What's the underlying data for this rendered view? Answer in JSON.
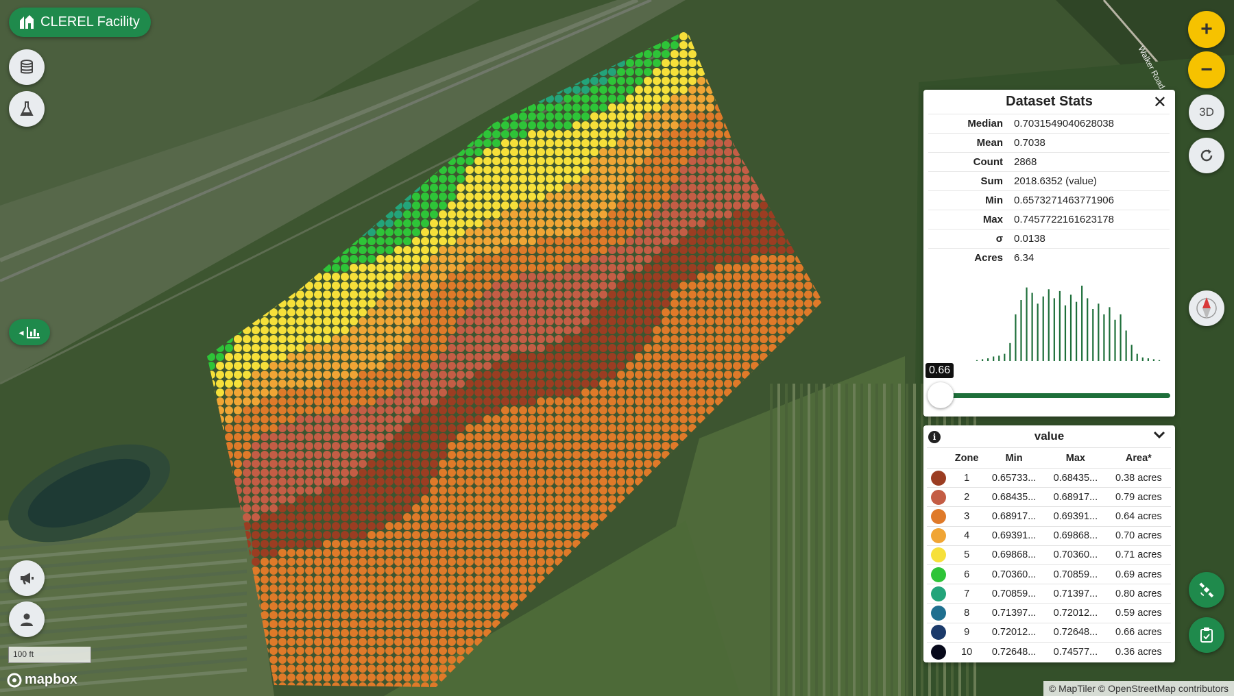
{
  "facility": {
    "label": "CLEREL Facility",
    "icon": "facility-logo-icon"
  },
  "left_controls": {
    "datasets": "database-icon",
    "lab": "flask-icon",
    "stats_toggle": "chart-icon",
    "announcements": "megaphone-icon",
    "account": "user-icon"
  },
  "right_controls": {
    "zoom_in": "+",
    "zoom_out": "−",
    "view_3d": "3D",
    "reset": "refresh-icon",
    "compass": "compass-icon",
    "satellite": "satellite-icon",
    "report": "clipboard-icon"
  },
  "map": {
    "scale_label": "100 ft",
    "logo_text": "mapbox",
    "attribution": "© MapTiler © OpenStreetMap contributors",
    "road_label": "Walker Road"
  },
  "stats": {
    "title": "Dataset Stats",
    "close": "✕",
    "rows": [
      {
        "key": "Median",
        "value": "0.7031549040628038"
      },
      {
        "key": "Mean",
        "value": "0.7038"
      },
      {
        "key": "Count",
        "value": "2868"
      },
      {
        "key": "Sum",
        "value": "2018.6352 (value)"
      },
      {
        "key": "Min",
        "value": "0.6573271463771906"
      },
      {
        "key": "Max",
        "value": "0.7457722161623178"
      },
      {
        "key": "σ",
        "value": "0.0138"
      },
      {
        "key": "Acres",
        "value": "6.34"
      }
    ],
    "histogram": [
      1,
      2,
      3,
      5,
      6,
      8,
      20,
      52,
      68,
      82,
      76,
      64,
      72,
      80,
      70,
      78,
      62,
      74,
      66,
      84,
      70,
      58,
      64,
      52,
      60,
      46,
      52,
      34,
      18,
      8,
      4,
      3,
      2,
      1
    ],
    "slider_value": "0.66",
    "slider_fraction": 0.0
  },
  "legend": {
    "title": "value",
    "headers": [
      "Zone",
      "Min",
      "Max",
      "Area*"
    ],
    "zones": [
      {
        "zone": "1",
        "min": "0.65733...",
        "max": "0.68435...",
        "area": "0.38 acres",
        "color": "#9b3d22"
      },
      {
        "zone": "2",
        "min": "0.68435...",
        "max": "0.68917...",
        "area": "0.79 acres",
        "color": "#c45d45"
      },
      {
        "zone": "3",
        "min": "0.68917...",
        "max": "0.69391...",
        "area": "0.64 acres",
        "color": "#df7a29"
      },
      {
        "zone": "4",
        "min": "0.69391...",
        "max": "0.69868...",
        "area": "0.70 acres",
        "color": "#f0a535"
      },
      {
        "zone": "5",
        "min": "0.69868...",
        "max": "0.70360...",
        "area": "0.71 acres",
        "color": "#f6e03a"
      },
      {
        "zone": "6",
        "min": "0.70360...",
        "max": "0.70859...",
        "area": "0.69 acres",
        "color": "#2ec438"
      },
      {
        "zone": "7",
        "min": "0.70859...",
        "max": "0.71397...",
        "area": "0.80 acres",
        "color": "#23a47a"
      },
      {
        "zone": "8",
        "min": "0.71397...",
        "max": "0.72012...",
        "area": "0.59 acres",
        "color": "#1f6f8f"
      },
      {
        "zone": "9",
        "min": "0.72012...",
        "max": "0.72648...",
        "area": "0.66 acres",
        "color": "#1b3a6a"
      },
      {
        "zone": "10",
        "min": "0.72648...",
        "max": "0.74577...",
        "area": "0.36 acres",
        "color": "#07091a"
      }
    ]
  }
}
